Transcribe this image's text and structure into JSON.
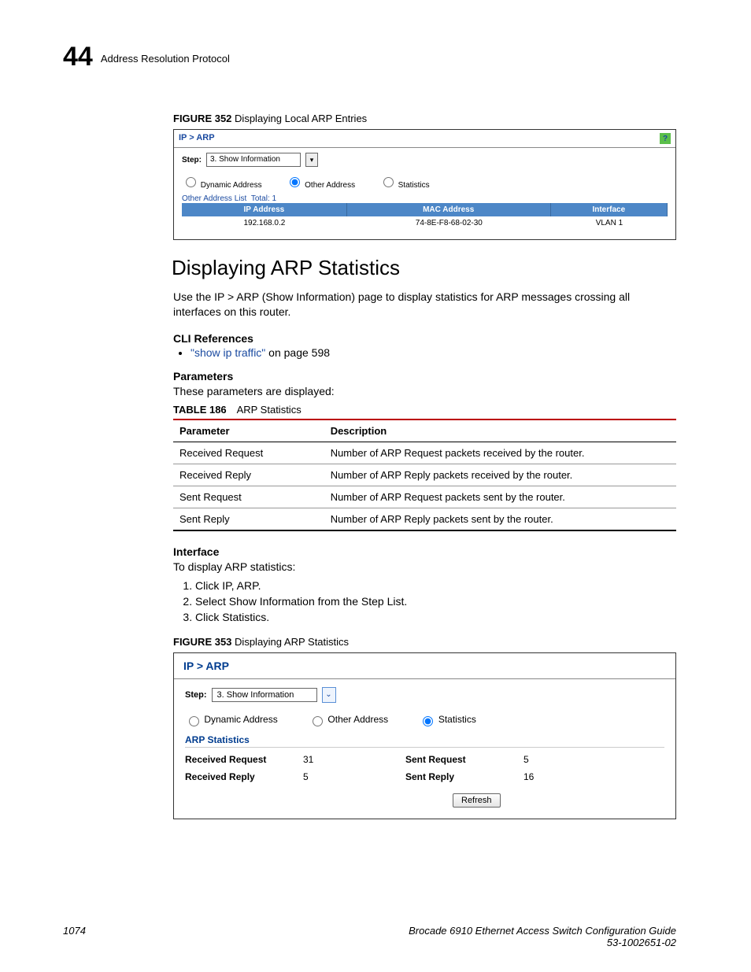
{
  "runningHead": {
    "chapter": "44",
    "title": "Address Resolution Protocol"
  },
  "fig352": {
    "label": "FIGURE 352",
    "caption": "Displaying Local ARP Entries",
    "breadcrumb": "IP > ARP",
    "stepLabel": "Step:",
    "stepValue": "3. Show Information",
    "radio": {
      "dynamic": "Dynamic Address",
      "other": "Other Address",
      "stats": "Statistics"
    },
    "listLabel": "Other Address List",
    "listTotal": "Total: 1",
    "th": {
      "ip": "IP Address",
      "mac": "MAC Address",
      "iface": "Interface"
    },
    "row": {
      "ip": "192.168.0.2",
      "mac": "74-8E-F8-68-02-30",
      "iface": "VLAN 1"
    }
  },
  "section": {
    "title": "Displaying ARP Statistics",
    "intro": "Use the IP > ARP (Show Information) page to display statistics for ARP messages crossing all interfaces on this router.",
    "cliRefHeading": "CLI References",
    "cliLink": "\"show ip traffic\"",
    "cliLinkSuffix": " on page 598",
    "paramHeading": "Parameters",
    "paramIntro": "These parameters are displayed:",
    "tableLabel": "TABLE 186",
    "tableCaption": "ARP Statistics",
    "th": {
      "param": "Parameter",
      "desc": "Description"
    },
    "rows": [
      {
        "param": "Received Request",
        "desc": "Number of ARP Request packets received by the router."
      },
      {
        "param": "Received Reply",
        "desc": "Number of ARP Reply packets received by the router."
      },
      {
        "param": "Sent Request",
        "desc": "Number of ARP Request packets sent by the router."
      },
      {
        "param": "Sent Reply",
        "desc": "Number of ARP Reply packets sent by the router."
      }
    ],
    "ifaceHeading": "Interface",
    "ifaceIntro": "To display ARP statistics:",
    "steps": [
      "Click IP, ARP.",
      "Select Show Information from the Step List.",
      "Click Statistics."
    ]
  },
  "fig353": {
    "label": "FIGURE 353",
    "caption": "Displaying ARP Statistics",
    "breadcrumb": "IP > ARP",
    "stepLabel": "Step:",
    "stepValue": "3. Show Information",
    "radio": {
      "dynamic": "Dynamic Address",
      "other": "Other Address",
      "stats": "Statistics"
    },
    "statsHdr": "ARP Statistics",
    "stats": {
      "rrq_label": "Received Request",
      "rrq_val": "31",
      "rrp_label": "Received Reply",
      "rrp_val": "5",
      "srq_label": "Sent Request",
      "srq_val": "5",
      "srp_label": "Sent Reply",
      "srp_val": "16"
    },
    "refresh": "Refresh"
  },
  "footer": {
    "page": "1074",
    "book": "Brocade 6910 Ethernet Access Switch Configuration Guide",
    "docnum": "53-1002651-02"
  }
}
